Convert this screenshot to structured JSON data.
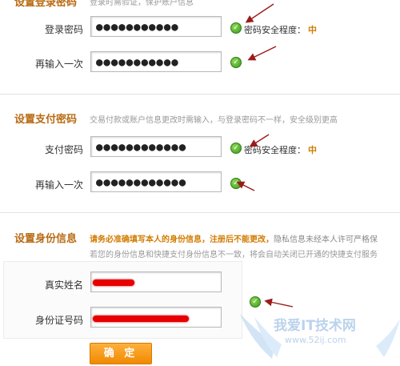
{
  "login_section": {
    "title_partial": "设置登录密码",
    "hint_partial": "登录时需验证，保护账户信息",
    "password_label": "登录密码",
    "password_value": "●●●●●●●●●●●",
    "confirm_label": "再输入一次",
    "confirm_value": "●●●●●●●●●●●",
    "strength_text": "密码安全程度：",
    "strength_level": "中"
  },
  "pay_section": {
    "title": "设置支付密码",
    "hint": "交易付款或账户信息更改时需输入，与登录密码不一样，安全级别更高",
    "password_label": "支付密码",
    "password_value": "●●●●●●●●●●●●",
    "confirm_label": "再输入一次",
    "confirm_value": "●●●●●●●●●●●●",
    "strength_text": "密码安全程度：",
    "strength_level": "中"
  },
  "identity_section": {
    "title": "设置身份信息",
    "warning_orange": "请务必准确填写本人的身份信息，注册后不能更改，",
    "warning_gray": "隐私信息未经本人许可严格保",
    "note": "若您的身份信息和快捷支付身份信息不一致，将会自动关闭已开通的快捷支付服务",
    "name_label": "真实姓名",
    "id_label": "身份证号码"
  },
  "confirm_button": "确 定",
  "watermark": {
    "main": "我爱IT技术网",
    "url": "www.52ij.com"
  },
  "colors": {
    "accent": "#b86a12",
    "button": "#f08a00",
    "ok": "#3b9a1a",
    "annotation_arrow": "#9b1b1b",
    "redaction": "#e60000"
  },
  "icons": [
    "check-ok-icon",
    "annotation-arrow"
  ]
}
